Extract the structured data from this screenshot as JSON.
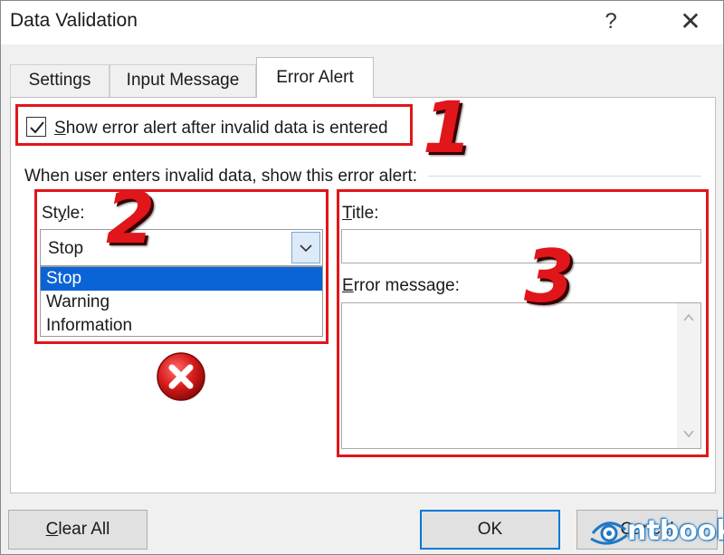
{
  "window": {
    "title": "Data Validation",
    "help_glyph": "?",
    "close_glyph": "✕"
  },
  "tabs": [
    {
      "label": "Settings",
      "active": false
    },
    {
      "label": "Input Message",
      "active": false
    },
    {
      "label": "Error Alert",
      "active": true
    }
  ],
  "show_alert": {
    "checked": true,
    "label_hotkey": "S",
    "label_rest": "how error alert after invalid data is entered"
  },
  "group_label": "When user enters invalid data, show this error alert:",
  "style": {
    "label_pre": "St",
    "label_hotkey": "y",
    "label_post": "le:",
    "value": "Stop",
    "options": [
      "Stop",
      "Warning",
      "Information"
    ],
    "highlighted_index": 0
  },
  "title_field": {
    "label_hotkey": "T",
    "label_rest": "itle:",
    "value": ""
  },
  "error_message": {
    "label_hotkey": "E",
    "label_rest": "rror message:",
    "value": ""
  },
  "annotations": [
    "1",
    "2",
    "3"
  ],
  "buttons": {
    "clear_hotkey": "C",
    "clear_rest": "lear All",
    "ok": "OK",
    "cancel": "Cancel"
  },
  "watermark_text": "ntbook",
  "colors": {
    "annotation_red": "#e0161b",
    "selection_blue": "#0a64d6",
    "ok_border": "#0078d7"
  }
}
